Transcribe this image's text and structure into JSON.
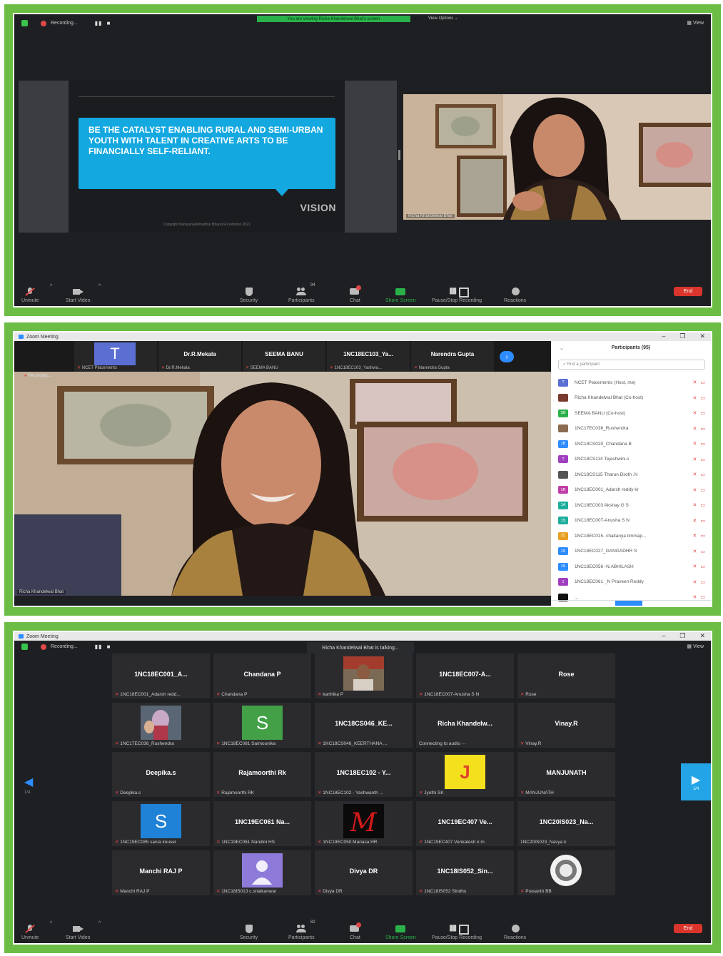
{
  "panel1": {
    "recording_label": "Recording...",
    "viewing_banner": "You are viewing Richa Khandelwal Bhat's screen",
    "view_options": "View Options ⌄",
    "view_label": "View",
    "slide": {
      "text": "BE THE CATALYST ENABLING RURAL AND SEMI-URBAN YOUTH WITH TALENT IN CREATIVE ARTS TO BE FINANCIALLY SELF-RELIANT.",
      "heading": "VISION",
      "copyright": "Copyright Narayana/Atmabhar Bharat Foundation 2021"
    },
    "camera_name": "Richa Khandelwal Bhat",
    "toolbar": {
      "unmute": "Unmute",
      "start_video": "Start Video",
      "security": "Security",
      "participants": "Participants",
      "participants_count": "94",
      "chat": "Chat",
      "share_screen": "Share Screen",
      "pause_stop": "Pause/Stop Recording",
      "reactions": "Reactions",
      "end": "End"
    }
  },
  "panel2": {
    "window_title": "Zoom Meeting",
    "strip": [
      {
        "name": "T",
        "sub": "NCET Placements"
      },
      {
        "name": "Dr.R.Mekala",
        "sub": "Dr.R.Mekala"
      },
      {
        "name": "SEEMA BANU",
        "sub": "SEEMA BANU"
      },
      {
        "name": "1NC18EC103_Ya...",
        "sub": "1NC18EC103_Yashwa..."
      },
      {
        "name": "Narendra Gupta",
        "sub": "Narendra Gupta"
      }
    ],
    "recording_label": "Recording...",
    "main_name": "Richa Khandelwal Bhat",
    "participants_header": "Participants (95)",
    "search_placeholder": "Find a participant",
    "participants": [
      {
        "initials": "T",
        "color": "#5b6fd2",
        "name": "NCET Placements (Host, me)"
      },
      {
        "initials": "",
        "color": "#7a3b2e",
        "name": "Richa Khandelwal Bhat (Co-host)"
      },
      {
        "initials": "SB",
        "color": "#2ab14a",
        "name": "SEEMA BANU (Co-host)"
      },
      {
        "initials": "",
        "color": "#8a6b4f",
        "name": "1NC17EC036_Rushendra"
      },
      {
        "initials": "1B",
        "color": "#2d8cff",
        "name": "1NC18CS020_Chandana B"
      },
      {
        "initials": "T",
        "color": "#a040c0",
        "name": "1NC18CS114 Tejashwini.s"
      },
      {
        "initials": "",
        "color": "#555555",
        "name": "1NC18CS115 Tharun Dixith .N"
      },
      {
        "initials": "1R",
        "color": "#c03fa8",
        "name": "1NC18EC001_Adarsh reddy kr"
      },
      {
        "initials": "1A",
        "color": "#1fae9c",
        "name": "1NC18EC003 Akshay G S"
      },
      {
        "initials": "1S",
        "color": "#1fae9c",
        "name": "1NC18EC007-Anusha S N"
      },
      {
        "initials": "1C",
        "color": "#e8a020",
        "name": "1NC18EC015- chaitanya timmap..."
      },
      {
        "initials": "1S",
        "color": "#2d8cff",
        "name": "1NC18EC027_GANGADHR S"
      },
      {
        "initials": "1S",
        "color": "#2d8cff",
        "name": "1NC18EC056 -N.ABHILASH"
      },
      {
        "initials": "1",
        "color": "#a040c0",
        "name": "1NC18EC061 _N Praveen Reddy"
      },
      {
        "initials": "",
        "color": "#111111",
        "name": "..."
      }
    ]
  },
  "panel3": {
    "window_title": "Zoom Meeting",
    "recording_label": "Recording...",
    "talking": "Richa Khandelwal Bhat is talking...",
    "view_label": "View",
    "page_left": "1/4",
    "page_right": "1/4",
    "tiles": [
      {
        "name": "1NC18EC001_A...",
        "sub": "1NC18EC001_Adarsh redd...",
        "muted": true
      },
      {
        "name": "Chandana P",
        "sub": "Chandana P",
        "muted": true
      },
      {
        "name": "",
        "sub": "karthika P",
        "muted": true,
        "pic": "photo-man"
      },
      {
        "name": "1NC18EC007-A...",
        "sub": "1NC18EC007-Anusha S N",
        "muted": true
      },
      {
        "name": "Rose",
        "sub": "Rose",
        "muted": true
      },
      {
        "name": "",
        "sub": "1NC17EC036_Rushendra",
        "muted": true,
        "pic": "photo-deity"
      },
      {
        "name": "",
        "sub": "1NC18EC081 Saimounika",
        "muted": true,
        "pic": "S-green"
      },
      {
        "name": "1NC18CS046_KE...",
        "sub": "1NC18CS046_KEERTHANA ...",
        "muted": true
      },
      {
        "name": "Richa  Khandelw...",
        "sub": "Connecting to audio ···",
        "muted": false
      },
      {
        "name": "Vinay.R",
        "sub": "Vinay.R",
        "muted": true
      },
      {
        "name": "Deepika.s",
        "sub": "Deepika.s",
        "muted": true
      },
      {
        "name": "Rajamoorthi Rk",
        "sub": "Rajamoorthi RK",
        "muted": true
      },
      {
        "name": "1NC18EC102 - Y...",
        "sub": "1NC18EC102 - Yashwanth ...",
        "muted": true
      },
      {
        "name": "",
        "sub": "Jyothi SK",
        "muted": true,
        "pic": "J-yellow"
      },
      {
        "name": "MANJUNATH",
        "sub": "MANJUNATH",
        "muted": true
      },
      {
        "name": "",
        "sub": "1NC19EC085 sania kouser",
        "muted": true,
        "pic": "S-blue"
      },
      {
        "name": "1NC19EC061 Na...",
        "sub": "1NC19EC061 Nandini HS",
        "muted": true
      },
      {
        "name": "",
        "sub": "1NC19EC050 Manasa HR",
        "muted": true,
        "pic": "M-red"
      },
      {
        "name": "1NC19EC407 Ve...",
        "sub": "1NC19EC407 Venkatesh k m",
        "muted": true
      },
      {
        "name": "1NC20IS023_Na...",
        "sub": "1NC20IS023_Navya k",
        "muted": false
      },
      {
        "name": "Manchi RAJ P",
        "sub": "Manchi RAJ P",
        "muted": true
      },
      {
        "name": "",
        "sub": "1NC18IS013 c.shaikanwar",
        "muted": true,
        "pic": "user-purple"
      },
      {
        "name": "Divya DR",
        "sub": "Divya DR",
        "muted": true
      },
      {
        "name": "1NC18IS052_Sin...",
        "sub": "1NC18IS052 Sindhu",
        "muted": true
      },
      {
        "name": "",
        "sub": "Prasanth BB",
        "muted": true,
        "pic": "logo-seal"
      }
    ],
    "toolbar": {
      "unmute": "Unmute",
      "start_video": "Start Video",
      "security": "Security",
      "participants": "Participants",
      "participants_count": "82",
      "chat": "Chat",
      "share_screen": "Share Screen",
      "pause_stop": "Pause/Stop Recording",
      "reactions": "Reactions",
      "end": "End"
    }
  }
}
